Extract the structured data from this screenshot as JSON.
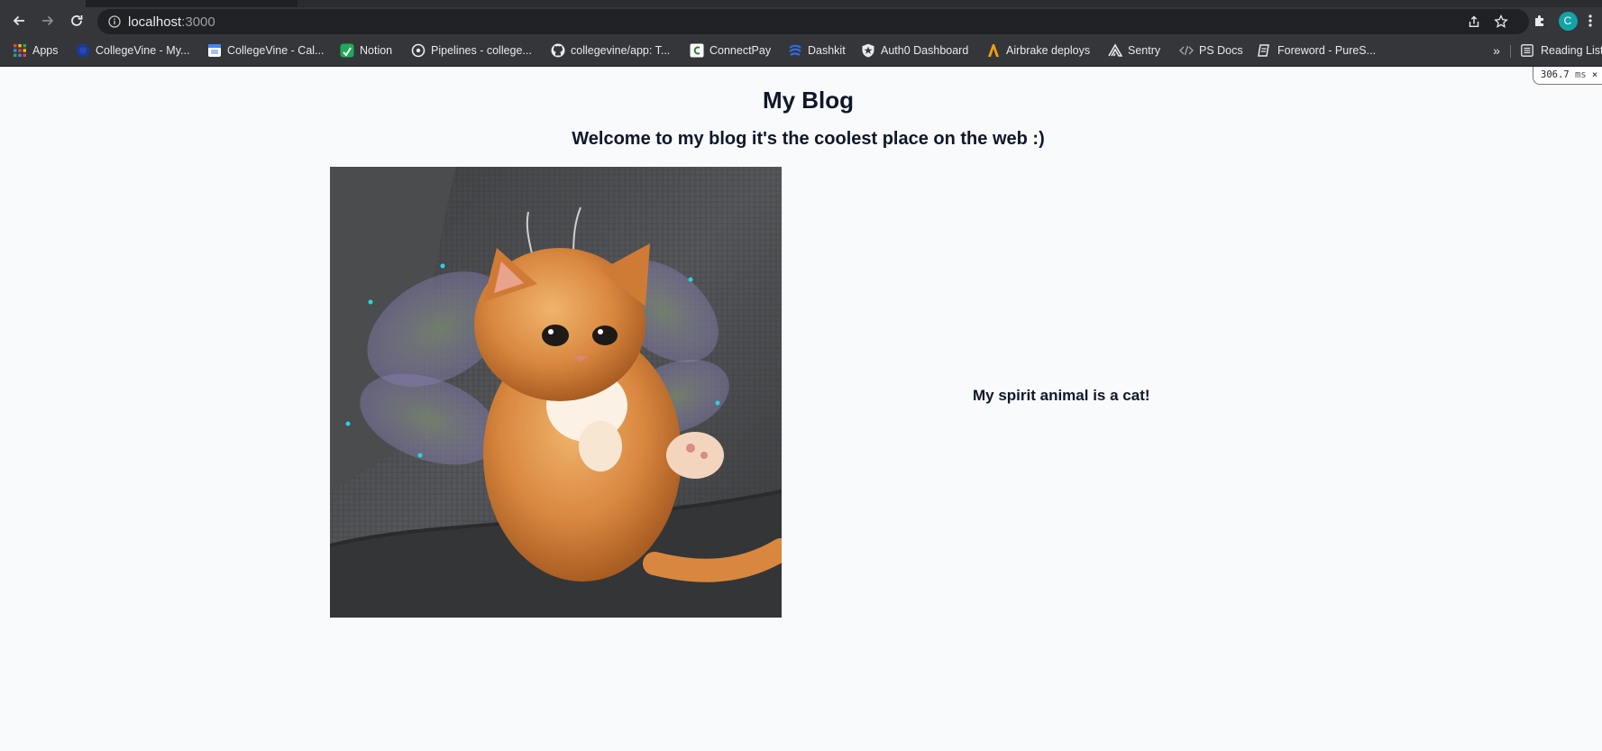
{
  "browser": {
    "url_host": "localhost",
    "url_port": ":3000",
    "profile_initial": "C",
    "bookmarks": [
      {
        "label": "Apps",
        "icon": "apps-grid-icon"
      },
      {
        "label": "CollegeVine - My...",
        "icon": "collegevine-icon"
      },
      {
        "label": "CollegeVine - Cal...",
        "icon": "calendar-icon"
      },
      {
        "label": "Notion",
        "icon": "notion-icon"
      },
      {
        "label": "Pipelines - college...",
        "icon": "pipelines-icon"
      },
      {
        "label": "collegevine/app: T...",
        "icon": "github-icon"
      },
      {
        "label": "ConnectPay",
        "icon": "connectpay-icon"
      },
      {
        "label": "Dashkit",
        "icon": "dashkit-icon"
      },
      {
        "label": "Auth0 Dashboard",
        "icon": "auth0-icon"
      },
      {
        "label": "Airbrake deploys",
        "icon": "airbrake-icon"
      },
      {
        "label": "Sentry",
        "icon": "sentry-icon"
      },
      {
        "label": "PS Docs",
        "icon": "ps-docs-icon"
      },
      {
        "label": "Foreword - PureS...",
        "icon": "foreword-icon"
      }
    ],
    "overflow_label": "»",
    "reading_list_label": "Reading List"
  },
  "perf_badge": {
    "value": "306.7",
    "unit": "ms",
    "close": "×"
  },
  "page": {
    "title": "My Blog",
    "subtitle": "Welcome to my blog it's the coolest place on the web :)",
    "caption": "My spirit animal is a cat!"
  },
  "colors": {
    "page_background": "#f8fafc",
    "text": "#0f172a",
    "chrome_toolbar": "#35363a",
    "omnibox": "#202124",
    "profile": "#12a3a8"
  }
}
